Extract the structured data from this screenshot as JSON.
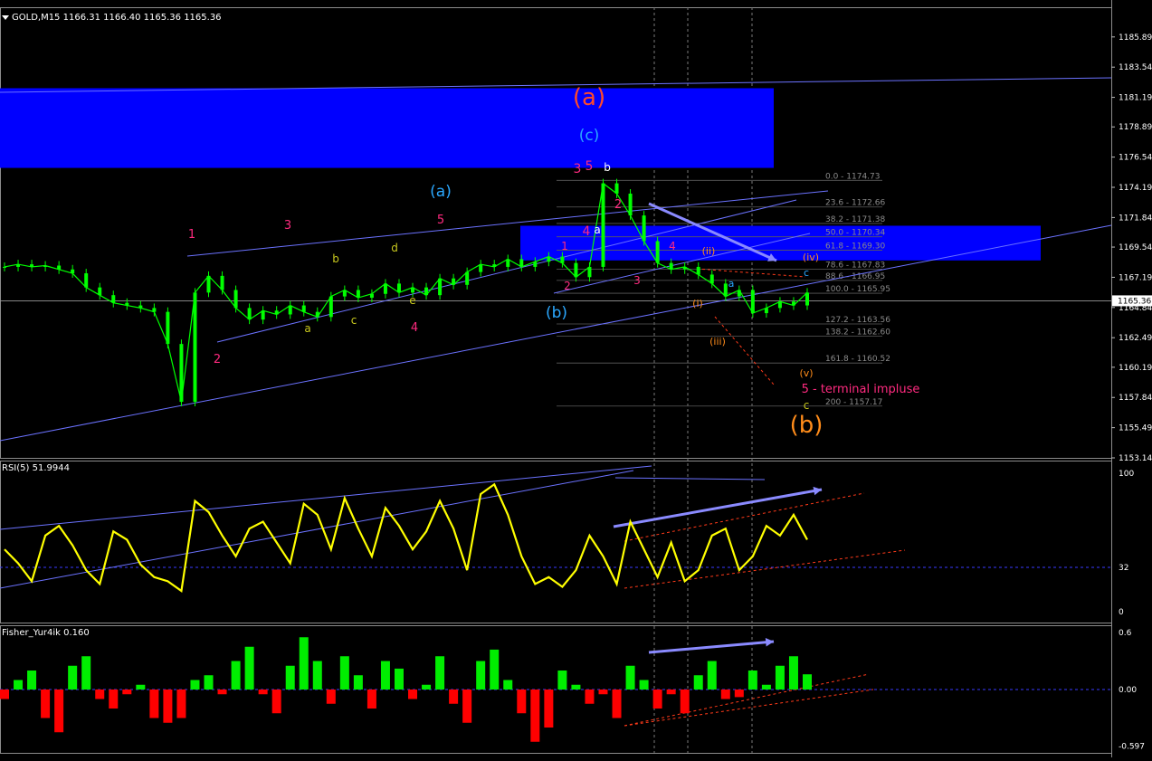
{
  "main_title": "GOLD,M15  1166.31 1166.40 1165.36 1165.36",
  "rsi_title": "RSI(5) 51.9944",
  "fisher_title": "Fisher_Yur4ik 0.160",
  "colors": {
    "background": "#000000",
    "candles": "#00ff00",
    "zone": "#0000ff",
    "channel": "#6b72ff",
    "rsi_line": "#ffff00",
    "fisher_pos": "#00ee00",
    "fisher_neg": "#ff0000",
    "wave_magenta": "#ff2a7f",
    "wave_cyan": "#2ba8ff",
    "wave_yellow": "#c8c81e",
    "wave_orange": "#ff8c1a",
    "wave_red": "#ff4a2a"
  },
  "chart_data": [
    {
      "type": "line",
      "pane": "main",
      "symbol": "GOLD",
      "timeframe": "M15",
      "ohlc": {
        "open": 1166.31,
        "high": 1166.4,
        "low": 1165.36,
        "close": 1165.36
      },
      "current_price": "1165.36",
      "y_ticks": [
        "1185.89",
        "1183.54",
        "1181.19",
        "1178.89",
        "1176.54",
        "1174.19",
        "1171.84",
        "1169.54",
        "1167.19",
        "1164.84",
        "1162.49",
        "1160.19",
        "1157.84",
        "1155.49",
        "1153.14"
      ],
      "x": [
        0,
        4,
        8,
        12,
        16,
        20,
        24,
        28,
        32,
        36,
        40,
        44,
        48,
        52,
        56,
        60,
        64,
        68,
        72,
        76,
        80,
        84,
        88,
        92,
        96,
        100,
        104,
        108,
        112,
        116,
        120,
        124,
        128,
        132,
        136,
        140,
        144,
        148,
        152,
        156,
        160,
        164,
        168,
        172,
        176,
        180,
        184,
        188,
        192,
        196,
        200,
        204,
        208,
        212,
        216,
        220,
        224,
        228,
        232,
        236
      ],
      "values": [
        1168.0,
        1168.2,
        1168.0,
        1168.1,
        1167.8,
        1167.5,
        1166.4,
        1165.8,
        1165.2,
        1165.0,
        1164.8,
        1164.5,
        1162.0,
        1157.5,
        1166.0,
        1167.3,
        1166.2,
        1164.8,
        1163.9,
        1164.6,
        1164.3,
        1165.0,
        1164.5,
        1164.1,
        1165.7,
        1166.2,
        1165.6,
        1165.9,
        1166.7,
        1166.0,
        1166.4,
        1165.8,
        1167.1,
        1166.6,
        1167.6,
        1168.2,
        1168.0,
        1168.6,
        1168.0,
        1168.4,
        1168.8,
        1168.3,
        1167.2,
        1168.0,
        1174.5,
        1173.7,
        1172.0,
        1170.0,
        1168.3,
        1167.8,
        1168.0,
        1167.4,
        1166.7,
        1165.7,
        1166.2,
        1164.4,
        1164.8,
        1165.3,
        1165.0,
        1166.0
      ],
      "zones": [
        {
          "from": 1175.7,
          "to": 1181.9
        },
        {
          "from": 1168.5,
          "to": 1171.2
        }
      ],
      "fibonacci": [
        {
          "level": "0.0",
          "price": "1174.73"
        },
        {
          "level": "23.6",
          "price": "1172.66"
        },
        {
          "level": "38.2",
          "price": "1171.38"
        },
        {
          "level": "50.0",
          "price": "1170.34"
        },
        {
          "level": "61.8",
          "price": "1169.30"
        },
        {
          "level": "78.6",
          "price": "1167.83"
        },
        {
          "level": "88.6",
          "price": "1166.95"
        },
        {
          "level": "100.0",
          "price": "1165.95"
        },
        {
          "level": "127.2",
          "price": "1163.56"
        },
        {
          "level": "138.2",
          "price": "1162.60"
        },
        {
          "level": "161.8",
          "price": "1160.52"
        },
        {
          "level": "200",
          "price": "1157.17"
        }
      ],
      "wave_labels": [
        {
          "text": "1",
          "color": "magenta"
        },
        {
          "text": "2",
          "color": "magenta"
        },
        {
          "text": "3",
          "color": "magenta"
        },
        {
          "text": "4",
          "color": "magenta"
        },
        {
          "text": "5",
          "color": "magenta"
        },
        {
          "text": "a",
          "color": "yellow"
        },
        {
          "text": "b",
          "color": "yellow"
        },
        {
          "text": "c",
          "color": "yellow"
        },
        {
          "text": "d",
          "color": "yellow"
        },
        {
          "text": "e",
          "color": "yellow"
        },
        {
          "text": "(a)",
          "color": "cyan"
        },
        {
          "text": "(b)",
          "color": "cyan"
        },
        {
          "text": "(c)",
          "color": "cyan"
        },
        {
          "text": "(a)",
          "color": "red"
        },
        {
          "text": "(b)",
          "color": "orange"
        },
        {
          "text": "3",
          "color": "magenta"
        },
        {
          "text": "5",
          "color": "magenta"
        },
        {
          "text": "b",
          "color": "white"
        },
        {
          "text": "4",
          "color": "magenta"
        },
        {
          "text": "a",
          "color": "white"
        },
        {
          "text": "2",
          "color": "magenta"
        },
        {
          "text": "1",
          "color": "magenta"
        },
        {
          "text": "2",
          "color": "magenta"
        },
        {
          "text": "3",
          "color": "magenta"
        },
        {
          "text": "4",
          "color": "magenta"
        },
        {
          "text": "(i)",
          "color": "orange"
        },
        {
          "text": "(ii)",
          "color": "orange"
        },
        {
          "text": "(iii)",
          "color": "orange"
        },
        {
          "text": "(iv)",
          "color": "orange"
        },
        {
          "text": "(v)",
          "color": "orange"
        },
        {
          "text": "a",
          "color": "cyan"
        },
        {
          "text": "c",
          "color": "cyan"
        },
        {
          "text": "c",
          "color": "yellow"
        },
        {
          "text": "5 - terminal impluse",
          "color": "magenta"
        }
      ]
    },
    {
      "type": "line",
      "pane": "rsi",
      "name": "RSI(5)",
      "last_value": 51.9944,
      "y_ticks": [
        "100",
        "32",
        "0"
      ],
      "x": [
        0,
        4,
        8,
        12,
        16,
        20,
        24,
        28,
        32,
        36,
        40,
        44,
        48,
        52,
        56,
        60,
        64,
        68,
        72,
        76,
        80,
        84,
        88,
        92,
        96,
        100,
        104,
        108,
        112,
        116,
        120,
        124,
        128,
        132,
        136,
        140,
        144,
        148,
        152,
        156,
        160,
        164,
        168,
        172,
        176,
        180,
        184,
        188,
        192,
        196,
        200,
        204,
        208,
        212,
        216,
        220,
        224,
        228,
        232,
        236
      ],
      "values": [
        45,
        35,
        22,
        55,
        62,
        48,
        30,
        20,
        58,
        52,
        34,
        25,
        22,
        15,
        80,
        72,
        55,
        40,
        60,
        65,
        50,
        35,
        78,
        70,
        45,
        82,
        60,
        40,
        75,
        62,
        45,
        58,
        80,
        60,
        30,
        85,
        92,
        70,
        40,
        20,
        25,
        18,
        30,
        55,
        40,
        20,
        65,
        45,
        25,
        50,
        22,
        30,
        55,
        60,
        30,
        40,
        62,
        55,
        70,
        52
      ],
      "reference_levels": [
        32
      ]
    },
    {
      "type": "bar",
      "pane": "fisher",
      "name": "Fisher_Yur4ik",
      "last_value": 0.16,
      "y_ticks": [
        "0.6",
        "0.00",
        "-0.597"
      ],
      "x": [
        0,
        4,
        8,
        12,
        16,
        20,
        24,
        28,
        32,
        36,
        40,
        44,
        48,
        52,
        56,
        60,
        64,
        68,
        72,
        76,
        80,
        84,
        88,
        92,
        96,
        100,
        104,
        108,
        112,
        116,
        120,
        124,
        128,
        132,
        136,
        140,
        144,
        148,
        152,
        156,
        160,
        164,
        168,
        172,
        176,
        180,
        184,
        188,
        192,
        196,
        200,
        204,
        208,
        212,
        216,
        220,
        224,
        228,
        232,
        236
      ],
      "values": [
        -0.1,
        0.1,
        0.2,
        -0.3,
        -0.45,
        0.25,
        0.35,
        -0.1,
        -0.2,
        -0.05,
        0.05,
        -0.3,
        -0.35,
        -0.3,
        0.1,
        0.15,
        -0.05,
        0.3,
        0.45,
        -0.05,
        -0.25,
        0.25,
        0.55,
        0.3,
        -0.15,
        0.35,
        0.15,
        -0.2,
        0.3,
        0.22,
        -0.1,
        0.05,
        0.35,
        -0.15,
        -0.35,
        0.3,
        0.42,
        0.1,
        -0.25,
        -0.55,
        -0.4,
        0.2,
        0.05,
        -0.15,
        -0.05,
        -0.3,
        0.25,
        0.1,
        -0.2,
        -0.05,
        -0.25,
        0.15,
        0.3,
        -0.1,
        -0.08,
        0.2,
        0.05,
        0.25,
        0.35,
        0.16
      ],
      "reference_levels": [
        0
      ]
    }
  ]
}
